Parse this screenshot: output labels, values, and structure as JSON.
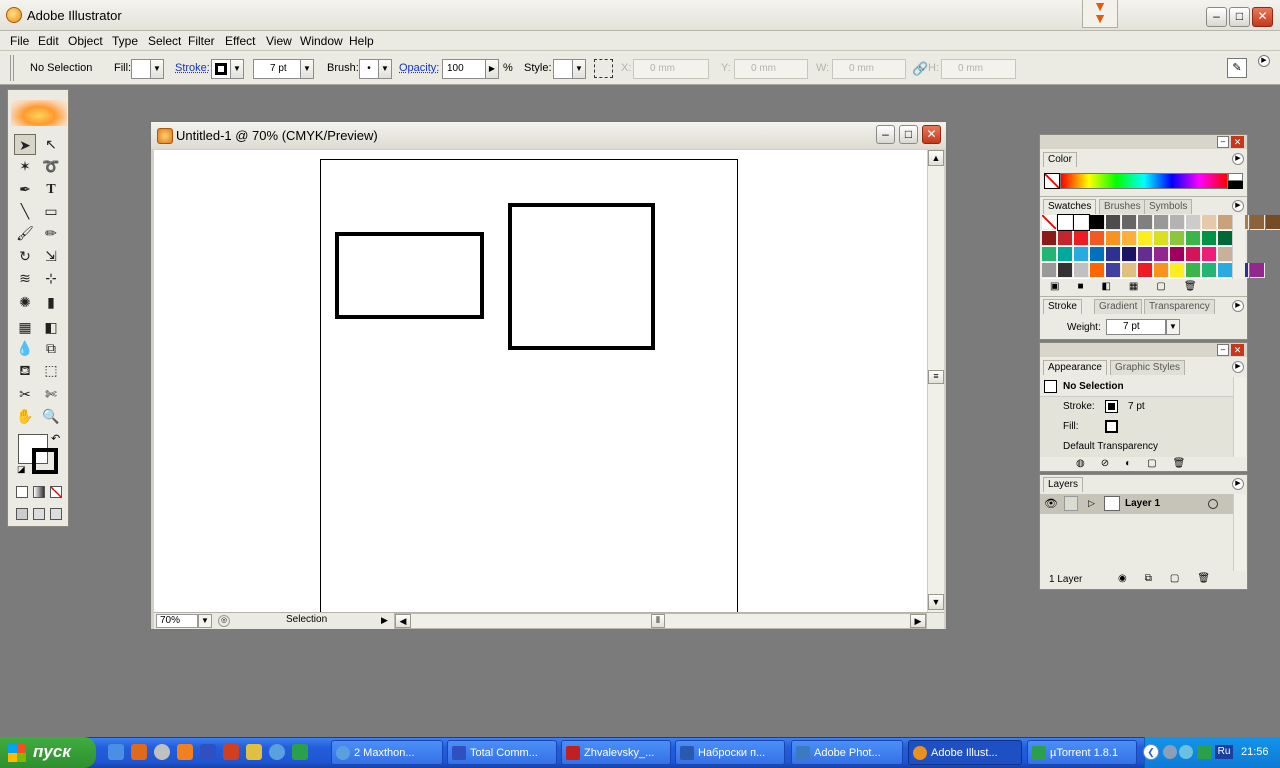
{
  "app": {
    "title": "Adobe Illustrator"
  },
  "menu": [
    "File",
    "Edit",
    "Object",
    "Type",
    "Select",
    "Filter",
    "Effect",
    "View",
    "Window",
    "Help"
  ],
  "control": {
    "selection": "No Selection",
    "fill_label": "Fill:",
    "stroke_label": "Stroke:",
    "stroke_weight": "7 pt",
    "brush_label": "Brush:",
    "brush_value": "•",
    "opacity_label": "Opacity:",
    "opacity_value": "100",
    "percent": "%",
    "style_label": "Style:",
    "x_label": "X:",
    "x_value": "0 mm",
    "y_label": "Y:",
    "y_value": "0 mm",
    "w_label": "W:",
    "w_value": "0 mm",
    "h_label": "H:",
    "h_value": "0 mm"
  },
  "document": {
    "title": "Untitled-1 @ 70% (CMYK/Preview)",
    "zoom": "70%",
    "status": "Selection"
  },
  "panels": {
    "color": {
      "tab": "Color"
    },
    "swatches": {
      "tabs": [
        "Swatches",
        "Brushes",
        "Symbols"
      ]
    },
    "stroke": {
      "tabs": [
        "Stroke",
        "Gradient",
        "Transparency"
      ],
      "weight_label": "Weight:",
      "weight_value": "7 pt"
    },
    "appearance": {
      "tabs": [
        "Appearance",
        "Graphic Styles"
      ],
      "title": "No Selection",
      "stroke_label": "Stroke:",
      "stroke_value": "7 pt",
      "fill_label": "Fill:",
      "transparency": "Default Transparency"
    },
    "layers": {
      "tab": "Layers",
      "layer_name": "Layer 1",
      "count": "1 Layer"
    }
  },
  "swatch_colors": [
    [
      "#ffffff",
      "#ffffff",
      "#ffffff",
      "#000000",
      "#4d4d4d",
      "#666666",
      "#808080",
      "#999999",
      "#b3b3b3",
      "#cccccc",
      "#e5c9a8",
      "#c9a27a",
      "#a87c52",
      "#8c6239",
      "#754c24"
    ],
    [
      "#8b1a1a",
      "#c1272d",
      "#ed1c24",
      "#f15a24",
      "#f7931e",
      "#fbb03b",
      "#fcee21",
      "#d9e021",
      "#8cc63f",
      "#39b54a",
      "#009245",
      "#006837"
    ],
    [
      "#22b573",
      "#00a99d",
      "#29abe2",
      "#0071bc",
      "#2e3192",
      "#1b1464",
      "#662d91",
      "#93278f",
      "#9e005d",
      "#d4145a",
      "#ed1e79",
      "#c7b299"
    ],
    [
      "#999999",
      "#333333",
      "#c0c0c0",
      "#ff6600",
      "#4040a0",
      "#e0c080",
      "#ed1c24",
      "#f7931e",
      "#fcee21",
      "#39b54a",
      "#22b573",
      "#29abe2",
      "#2e3192",
      "#93278f"
    ]
  ],
  "taskbar": {
    "start": "пуск",
    "tasks": [
      "2 Maxthon...",
      "Total Comm...",
      "Zhvalevsky_...",
      "Наброски п...",
      "Adobe Phot...",
      "Adobe Illust...",
      "µTorrent 1.8.1"
    ],
    "lang": "Ru",
    "clock": "21:56"
  }
}
